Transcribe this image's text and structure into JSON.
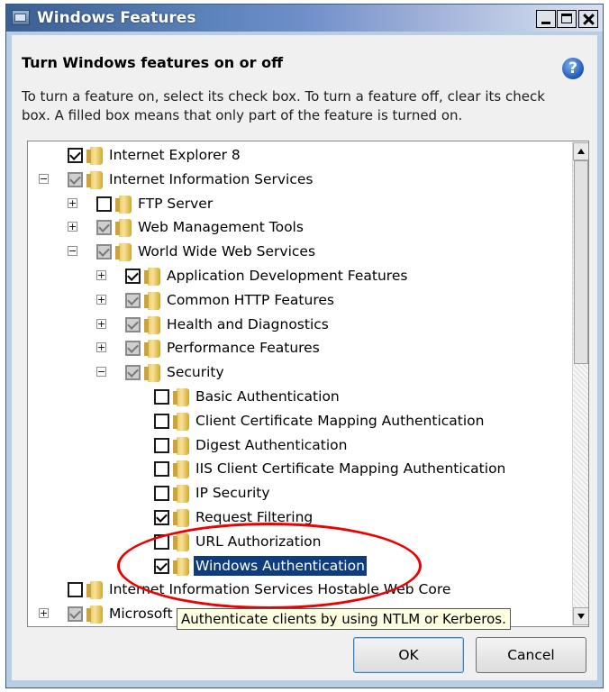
{
  "window": {
    "title": "Windows Features",
    "help_glyph": "?"
  },
  "header": {
    "heading": "Turn Windows features on or off",
    "description": "To turn a feature on, select its check box. To turn a feature off, clear its check box. A filled box means that only part of the feature is turned on."
  },
  "tree": {
    "items": [
      {
        "label": "Internet Explorer 8",
        "state": "checked",
        "expander": "",
        "level": 0
      },
      {
        "label": "Internet Information Services",
        "state": "partial",
        "expander": "−",
        "level": 0
      },
      {
        "label": "FTP Server",
        "state": "unchecked",
        "expander": "+",
        "level": 1
      },
      {
        "label": "Web Management Tools",
        "state": "partial",
        "expander": "+",
        "level": 1
      },
      {
        "label": "World Wide Web Services",
        "state": "partial",
        "expander": "−",
        "level": 1
      },
      {
        "label": "Application Development Features",
        "state": "checked",
        "expander": "+",
        "level": 2
      },
      {
        "label": "Common HTTP Features",
        "state": "partial",
        "expander": "+",
        "level": 2
      },
      {
        "label": "Health and Diagnostics",
        "state": "partial",
        "expander": "+",
        "level": 2
      },
      {
        "label": "Performance Features",
        "state": "partial",
        "expander": "+",
        "level": 2
      },
      {
        "label": "Security",
        "state": "partial",
        "expander": "−",
        "level": 2
      },
      {
        "label": "Basic Authentication",
        "state": "unchecked",
        "expander": "",
        "level": 3
      },
      {
        "label": "Client Certificate Mapping Authentication",
        "state": "unchecked",
        "expander": "",
        "level": 3
      },
      {
        "label": "Digest Authentication",
        "state": "unchecked",
        "expander": "",
        "level": 3
      },
      {
        "label": "IIS Client Certificate Mapping Authentication",
        "state": "unchecked",
        "expander": "",
        "level": 3
      },
      {
        "label": "IP Security",
        "state": "unchecked",
        "expander": "",
        "level": 3
      },
      {
        "label": "Request Filtering",
        "state": "checked",
        "expander": "",
        "level": 3
      },
      {
        "label": "URL Authorization",
        "state": "unchecked",
        "expander": "",
        "level": 3
      },
      {
        "label": "Windows Authentication",
        "state": "checked",
        "expander": "",
        "level": 3,
        "selected": true
      },
      {
        "label": "Internet Information Services Hostable Web Core",
        "state": "unchecked",
        "expander": "",
        "level": 0
      },
      {
        "label": "Microsoft",
        "state": "partial",
        "expander": "+",
        "level": 0
      }
    ]
  },
  "tooltip": {
    "text": "Authenticate clients by using NTLM or Kerberos."
  },
  "buttons": {
    "ok_label": "OK",
    "cancel_label": "Cancel"
  },
  "colors": {
    "selection": "#0f3c7d",
    "annotation": "#e00000",
    "tooltip_bg": "#ffffe1"
  }
}
